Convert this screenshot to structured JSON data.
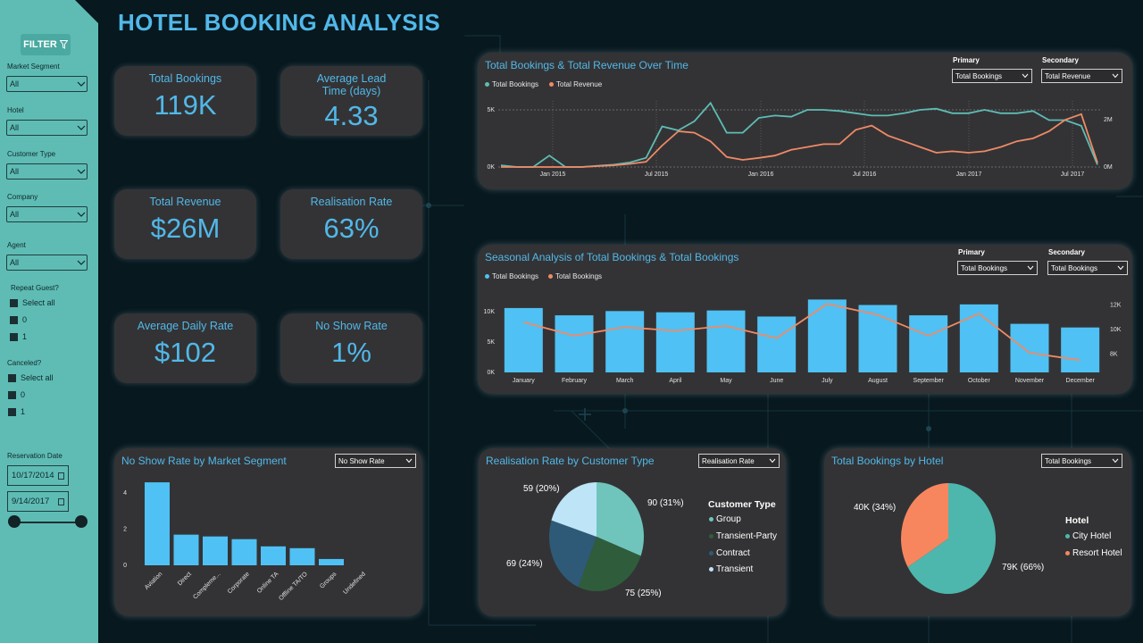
{
  "title": "HOTEL BOOKING ANALYSIS",
  "filter": {
    "title": "FILTER",
    "market_segment": {
      "label": "Market Segment",
      "value": "All"
    },
    "hotel": {
      "label": "Hotel",
      "value": "All"
    },
    "customer_type": {
      "label": "Customer Type",
      "value": "All"
    },
    "company": {
      "label": "Company",
      "value": "All"
    },
    "agent": {
      "label": "Agent",
      "value": "All"
    },
    "repeat_guest": {
      "label": "Repeat Guest?",
      "options": [
        "Select all",
        "0",
        "1"
      ]
    },
    "canceled": {
      "label": "Canceled?",
      "options": [
        "Select all",
        "0",
        "1"
      ]
    },
    "reservation_date": {
      "label": "Reservation Date",
      "start": "10/17/2014",
      "end": "9/14/2017"
    }
  },
  "kpis": [
    {
      "label": "Total Bookings",
      "value": "119K"
    },
    {
      "label": "Average Lead Time (days)",
      "value": "4.33"
    },
    {
      "label": "Total Revenue",
      "value": "$26M"
    },
    {
      "label": "Realisation Rate",
      "value": "63%"
    },
    {
      "label": "Average Daily Rate",
      "value": "$102"
    },
    {
      "label": "No Show Rate",
      "value": "1%"
    }
  ],
  "colors": {
    "accent": "#51b8e9",
    "teal": "#5ebcb4",
    "orange": "#f08a66",
    "panel": "#333335"
  },
  "time_panel": {
    "title": "Total Bookings & Total Revenue Over Time",
    "primary_label": "Primary",
    "primary_value": "Total Bookings",
    "secondary_label": "Secondary",
    "secondary_value": "Total Revenue"
  },
  "seasonal_panel": {
    "title": "Seasonal Analysis of Total Bookings & Total Bookings",
    "primary_label": "Primary",
    "primary_value": "Total Bookings",
    "secondary_label": "Secondary",
    "secondary_value": "Total Bookings"
  },
  "noshow_panel": {
    "title": "No Show Rate by Market Segment",
    "dropdown": "No Show Rate"
  },
  "realisation_panel": {
    "title": "Realisation Rate by Customer Type",
    "dropdown": "Realisation Rate",
    "legend_title": "Customer Type"
  },
  "hotel_panel": {
    "title": "Total Bookings by Hotel",
    "dropdown": "Total Bookings",
    "legend_title": "Hotel"
  },
  "chart_data": [
    {
      "type": "line",
      "title": "Total Bookings & Total Revenue Over Time",
      "x_ticks": [
        "Jan 2015",
        "Jul 2015",
        "Jan 2016",
        "Jul 2016",
        "Jan 2017",
        "Jul 2017"
      ],
      "y_ticks_left": [
        "0K",
        "5K"
      ],
      "y_ticks_right": [
        "0M",
        "2M"
      ],
      "ylim_left": [
        0,
        5000
      ],
      "ylim_right": [
        0,
        2000000
      ],
      "grid": true,
      "legend": "top-left",
      "x": [
        "2014-10",
        "2014-11",
        "2014-12",
        "2015-01",
        "2015-02",
        "2015-03",
        "2015-04",
        "2015-05",
        "2015-06",
        "2015-07",
        "2015-08",
        "2015-09",
        "2015-10",
        "2015-11",
        "2015-12",
        "2016-01",
        "2016-02",
        "2016-03",
        "2016-04",
        "2016-05",
        "2016-06",
        "2016-07",
        "2016-08",
        "2016-09",
        "2016-10",
        "2016-11",
        "2016-12",
        "2017-01",
        "2017-02",
        "2017-03",
        "2017-04",
        "2017-05",
        "2017-06",
        "2017-07",
        "2017-08",
        "2017-09"
      ],
      "series": [
        {
          "name": "Total Bookings",
          "color": "#5ebcb4",
          "values": [
            150,
            0,
            0,
            1000,
            0,
            0,
            100,
            200,
            400,
            800,
            3550,
            3200,
            4000,
            5600,
            3000,
            3000,
            4300,
            4500,
            4400,
            5000,
            5000,
            4900,
            4700,
            4500,
            4500,
            4700,
            5000,
            5100,
            4700,
            4700,
            5000,
            4700,
            4700,
            4900,
            4100,
            4100,
            3600,
            200
          ]
        },
        {
          "name": "Total Revenue",
          "color": "#f08a66",
          "values": [
            0,
            0,
            0,
            0,
            0,
            0,
            30000,
            60000,
            110000,
            180000,
            750000,
            1250000,
            1200000,
            900000,
            350000,
            250000,
            320000,
            400000,
            600000,
            700000,
            800000,
            800000,
            1300000,
            1450000,
            1100000,
            900000,
            700000,
            500000,
            550000,
            500000,
            550000,
            700000,
            900000,
            1000000,
            1250000,
            1650000,
            1850000,
            150000
          ]
        }
      ]
    },
    {
      "type": "bar",
      "title": "Seasonal Analysis of Total Bookings & Total Bookings",
      "categories": [
        "January",
        "February",
        "March",
        "April",
        "May",
        "June",
        "July",
        "August",
        "September",
        "October",
        "November",
        "December"
      ],
      "y_ticks_left": [
        "0K",
        "5K",
        "10K"
      ],
      "y_ticks_right": [
        "8K",
        "10K",
        "12K"
      ],
      "ylim_left": [
        0,
        12500
      ],
      "ylim_right": [
        6500,
        12700
      ],
      "legend": "top-left",
      "series": [
        {
          "name": "Total Bookings",
          "color": "#4fc1f4",
          "values": [
            10600,
            9400,
            10100,
            9900,
            10200,
            9200,
            12000,
            11100,
            9400,
            11200,
            8000,
            7400
          ]
        },
        {
          "name": "Total Bookings",
          "color": "#f08a66",
          "values": [
            10600,
            9500,
            10200,
            9900,
            10300,
            9300,
            12100,
            11200,
            9500,
            11300,
            8100,
            7500
          ]
        }
      ]
    },
    {
      "type": "bar",
      "title": "No Show Rate by Market Segment",
      "categories": [
        "Aviation",
        "Direct",
        "Compleme...",
        "Corporate",
        "Online TA",
        "Offline TA/TO",
        "Groups",
        "Undefined"
      ],
      "values": [
        4.6,
        1.7,
        1.6,
        1.45,
        1.05,
        0.95,
        0.35,
        0
      ],
      "y_ticks": [
        "0",
        "2",
        "4"
      ],
      "ylim": [
        0,
        5
      ],
      "color": "#4fc1f4"
    },
    {
      "type": "pie",
      "title": "Realisation Rate by Customer Type",
      "categories": [
        "Group",
        "Transient-Party",
        "Contract",
        "Transient"
      ],
      "values": [
        90,
        75,
        69,
        59
      ],
      "labels": [
        "90 (31%)",
        "75 (25%)",
        "69 (24%)",
        "59 (20%)"
      ],
      "colors": [
        "#6fc5bb",
        "#2f5d3c",
        "#2e5a78",
        "#bde4f7"
      ],
      "legend": "right"
    },
    {
      "type": "pie",
      "title": "Total Bookings by Hotel",
      "categories": [
        "City Hotel",
        "Resort Hotel"
      ],
      "values": [
        79,
        40
      ],
      "labels": [
        "79K (66%)",
        "40K (34%)"
      ],
      "colors": [
        "#4db7ad",
        "#f7865f"
      ],
      "legend": "right"
    }
  ]
}
